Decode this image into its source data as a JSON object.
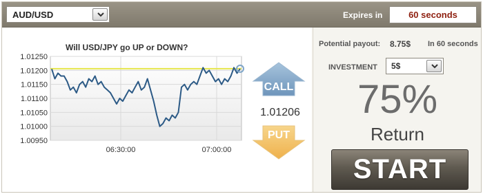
{
  "topbar": {
    "asset": "AUD/USD",
    "expires_label": "Expires in",
    "expires_value": "60 seconds"
  },
  "chart": {
    "question": "Will USD/JPY go UP or DOWN?",
    "current_price": "1.01206"
  },
  "actions": {
    "call_label": "CALL",
    "put_label": "PUT"
  },
  "payout": {
    "label": "Potential payout:",
    "value": "8.75$",
    "time": "In 60 seconds"
  },
  "investment": {
    "label": "INVESTMENT",
    "selected": "5$"
  },
  "return": {
    "percent": "75%",
    "label": "Return"
  },
  "start_label": "START",
  "colors": {
    "call": "#7fa6c8",
    "put": "#f1bf63",
    "price_line": "#2c5a86",
    "strike_line": "#e6e64a"
  },
  "chart_data": {
    "type": "line",
    "y_ticks": [
      "1.01250",
      "1.01200",
      "1.01150",
      "1.01100",
      "1.01050",
      "1.01000",
      "1.00950"
    ],
    "x_ticks": [
      "06:30:00",
      "07:00:00"
    ],
    "ylim": [
      1.0095,
      1.0125
    ],
    "strike": 1.01206,
    "series": [
      {
        "values": [
          1.01205,
          1.0117,
          1.0119,
          1.0118,
          1.0118,
          1.0116,
          1.0113,
          1.0114,
          1.0112,
          1.0115,
          1.0116,
          1.0114,
          1.0117,
          1.0116,
          1.0118,
          1.0115,
          1.0116,
          1.0114,
          1.0113,
          1.0112,
          1.011,
          1.0108,
          1.011,
          1.0109,
          1.0111,
          1.0113,
          1.0112,
          1.0114,
          1.0116,
          1.0113,
          1.0114,
          1.0117,
          1.0113,
          1.0109,
          1.0104,
          1.01,
          1.0101,
          1.0103,
          1.0102,
          1.0104,
          1.0103,
          1.0105,
          1.0114,
          1.0115,
          1.0113,
          1.0115,
          1.0116,
          1.0115,
          1.0118,
          1.0121,
          1.0119,
          1.012,
          1.0118,
          1.0116,
          1.0117,
          1.0115,
          1.0117,
          1.0116,
          1.0118,
          1.0121,
          1.0119,
          1.01206
        ]
      }
    ]
  }
}
